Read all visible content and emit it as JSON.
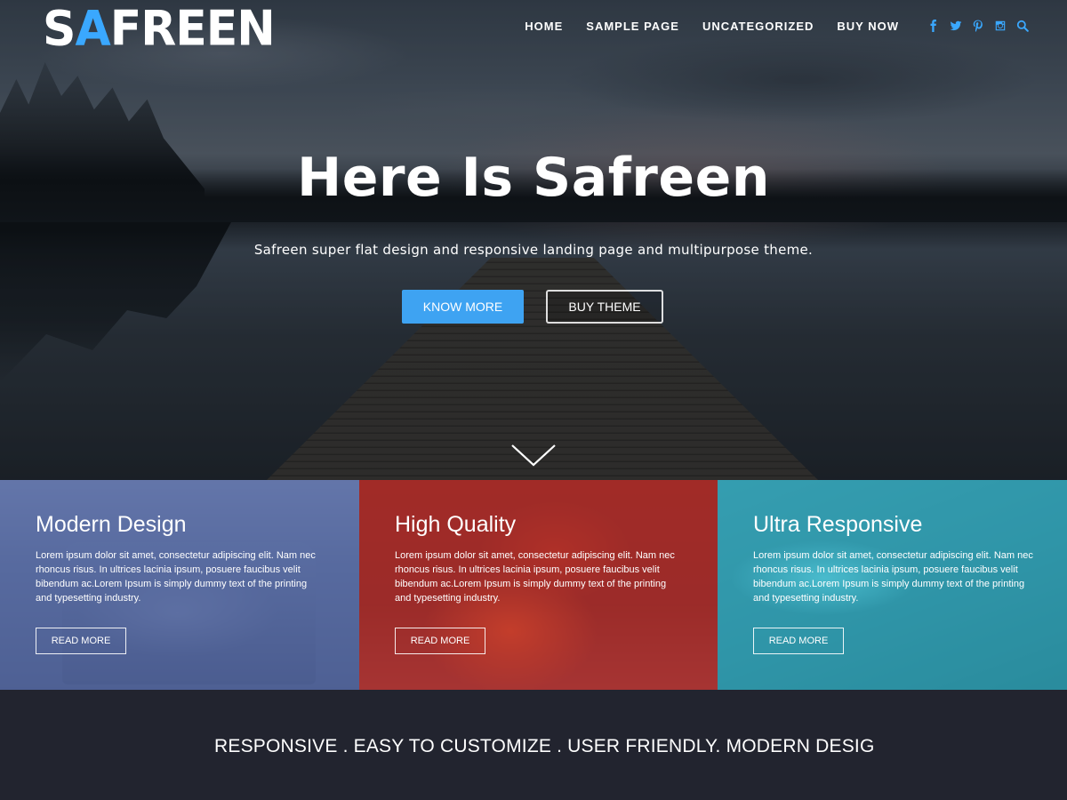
{
  "logo": {
    "part1": "S",
    "accent": "A",
    "part2": "FREEN"
  },
  "nav": {
    "items": [
      {
        "label": "HOME"
      },
      {
        "label": "SAMPLE PAGE"
      },
      {
        "label": "UNCATEGORIZED"
      },
      {
        "label": "BUY NOW"
      }
    ],
    "social_icons": [
      "facebook-icon",
      "twitter-icon",
      "pinterest-icon",
      "instagram-icon",
      "search-icon"
    ],
    "accent_color": "#3aa8ff"
  },
  "hero": {
    "title": "Here Is Safreen",
    "subtitle": "Safreen super flat design and responsive landing page and multipurpose theme.",
    "primary_button": "KNOW MORE",
    "secondary_button": "BUY THEME",
    "primary_color": "#3ea3f2"
  },
  "features": [
    {
      "title": "Modern Design",
      "text": "Lorem ipsum dolor sit amet, consectetur adipiscing elit. Nam nec rhoncus risus. In ultrices lacinia ipsum, posuere faucibus velit bibendum ac.Lorem Ipsum is simply dummy text of the printing and typesetting industry.",
      "button": "READ MORE",
      "color": "#546aaa"
    },
    {
      "title": "High Quality",
      "text": "Lorem ipsum dolor sit amet, consectetur adipiscing elit. Nam nec rhoncus risus. In ultrices lacinia ipsum, posuere faucibus velit bibendum ac.Lorem Ipsum is simply dummy text of the printing and typesetting industry.",
      "button": "READ MORE",
      "color": "#c42c28"
    },
    {
      "title": "Ultra Responsive",
      "text": "Lorem ipsum dolor sit amet, consectetur adipiscing elit. Nam nec rhoncus risus. In ultrices lacinia ipsum, posuere faucibus velit bibendum ac.Lorem Ipsum is simply dummy text of the printing and typesetting industry.",
      "button": "READ MORE",
      "color": "#28aabe"
    }
  ],
  "band": {
    "text": "RESPONSIVE . EASY TO CUSTOMIZE . USER FRIENDLY. MODERN DESIG"
  }
}
